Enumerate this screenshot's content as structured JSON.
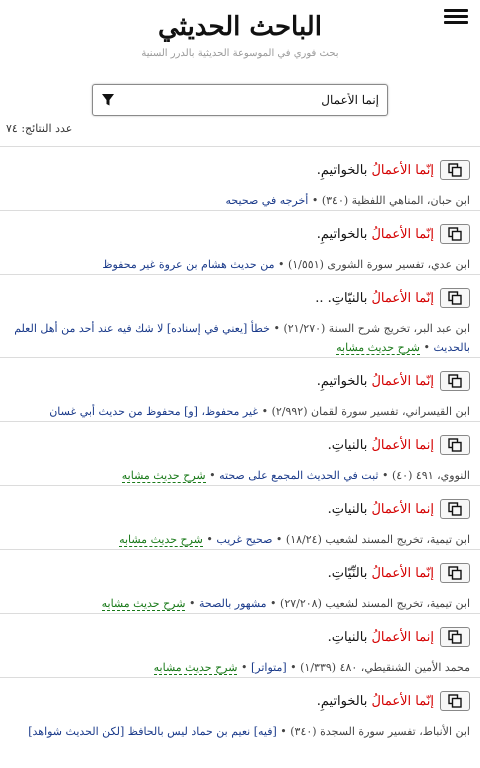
{
  "header": {
    "title": "الباحث الحديثي",
    "subtitle": "بحث فوري في الموسوعة الحديثية بالدرر السنية"
  },
  "search": {
    "value": "إنما الأعمال"
  },
  "results_count": "عدد النتائج: ٧٤",
  "results": [
    {
      "hl": "إنّما الأعمالُ",
      "rest": " بالخواتيمِ.",
      "source": "ابن حبان، المناهي اللفظية (٣٤٠)",
      "sep": " • ",
      "ruling": "أخرجه في صحيحه",
      "similar": ""
    },
    {
      "hl": "إنّما الأعمالُ",
      "rest": " بالخواتيمِ.",
      "source": "ابن عدي، تفسير سورة الشورى (١/٥٥١)",
      "sep": " • ",
      "ruling": "من حديث هشام بن عروة غير محفوظ",
      "similar": ""
    },
    {
      "hl": "إنّما الأعمالُ",
      "rest": " بالنيّاتِ. ..",
      "source": "ابن عبد البر، تخريج شرح السنة (٢١/٢٧٠)",
      "sep": " • ",
      "ruling": "خطأ [يعني في إسناده] لا شك فيه عند أحد من أهل العلم بالحديث",
      "similar": "شرح حديث مشابه"
    },
    {
      "hl": "إنّما الأعمالُ",
      "rest": " بالخواتيمِ.",
      "source": "ابن القيسراني، تفسير سورة لقمان (٢/٩٩٢)",
      "sep": " • ",
      "ruling": "غير محفوظ، [و] محفوظ من حديث أبي غسان",
      "similar": ""
    },
    {
      "hl": "إنما الأعمالُ",
      "rest": " بالنياتِ.",
      "source": "النووي، ٤٩١ (٤٠)",
      "sep": " • ",
      "ruling": "ثبت في الحديث المجمع على صحته",
      "similar": "شرح حديث مشابه"
    },
    {
      "hl": "إنما الأعمالُ",
      "rest": " بالنياتِ.",
      "source": "ابن تيمية، تخريج المسند لشعيب (١٨/٢٤)",
      "sep": " • ",
      "ruling": "صحيح غريب",
      "similar": "شرح حديث مشابه"
    },
    {
      "hl": "إنّما الأعمالُ",
      "rest": " بالنِّيّاتِ.",
      "source": "ابن تيمية، تخريج المسند لشعيب (٢٧/٢٠٨)",
      "sep": " • ",
      "ruling": "مشهور بالصحة",
      "similar": "شرح حديث مشابه"
    },
    {
      "hl": "إنما الأعمالُ",
      "rest": " بالنياتِ.",
      "source": "محمد الأمين الشنقيطي، ٤٨٠ (١/٣٣٩)",
      "sep": " • ",
      "ruling": "[متواتر]",
      "similar": "شرح حديث مشابه"
    },
    {
      "hl": "إنّما الأعمالُ",
      "rest": " بالخواتيمِ.",
      "source": "ابن الأنباط، تفسير سورة السجدة (٣٤٠)",
      "sep": " • ",
      "ruling": "[فيه] نعيم بن حماد ليس بالحافظ [لكن الحديث شواهد]",
      "similar": ""
    }
  ],
  "colors": {
    "highlight": "#d40000",
    "ruling": "#1a3a8a",
    "similar": "#1a7a1a"
  }
}
